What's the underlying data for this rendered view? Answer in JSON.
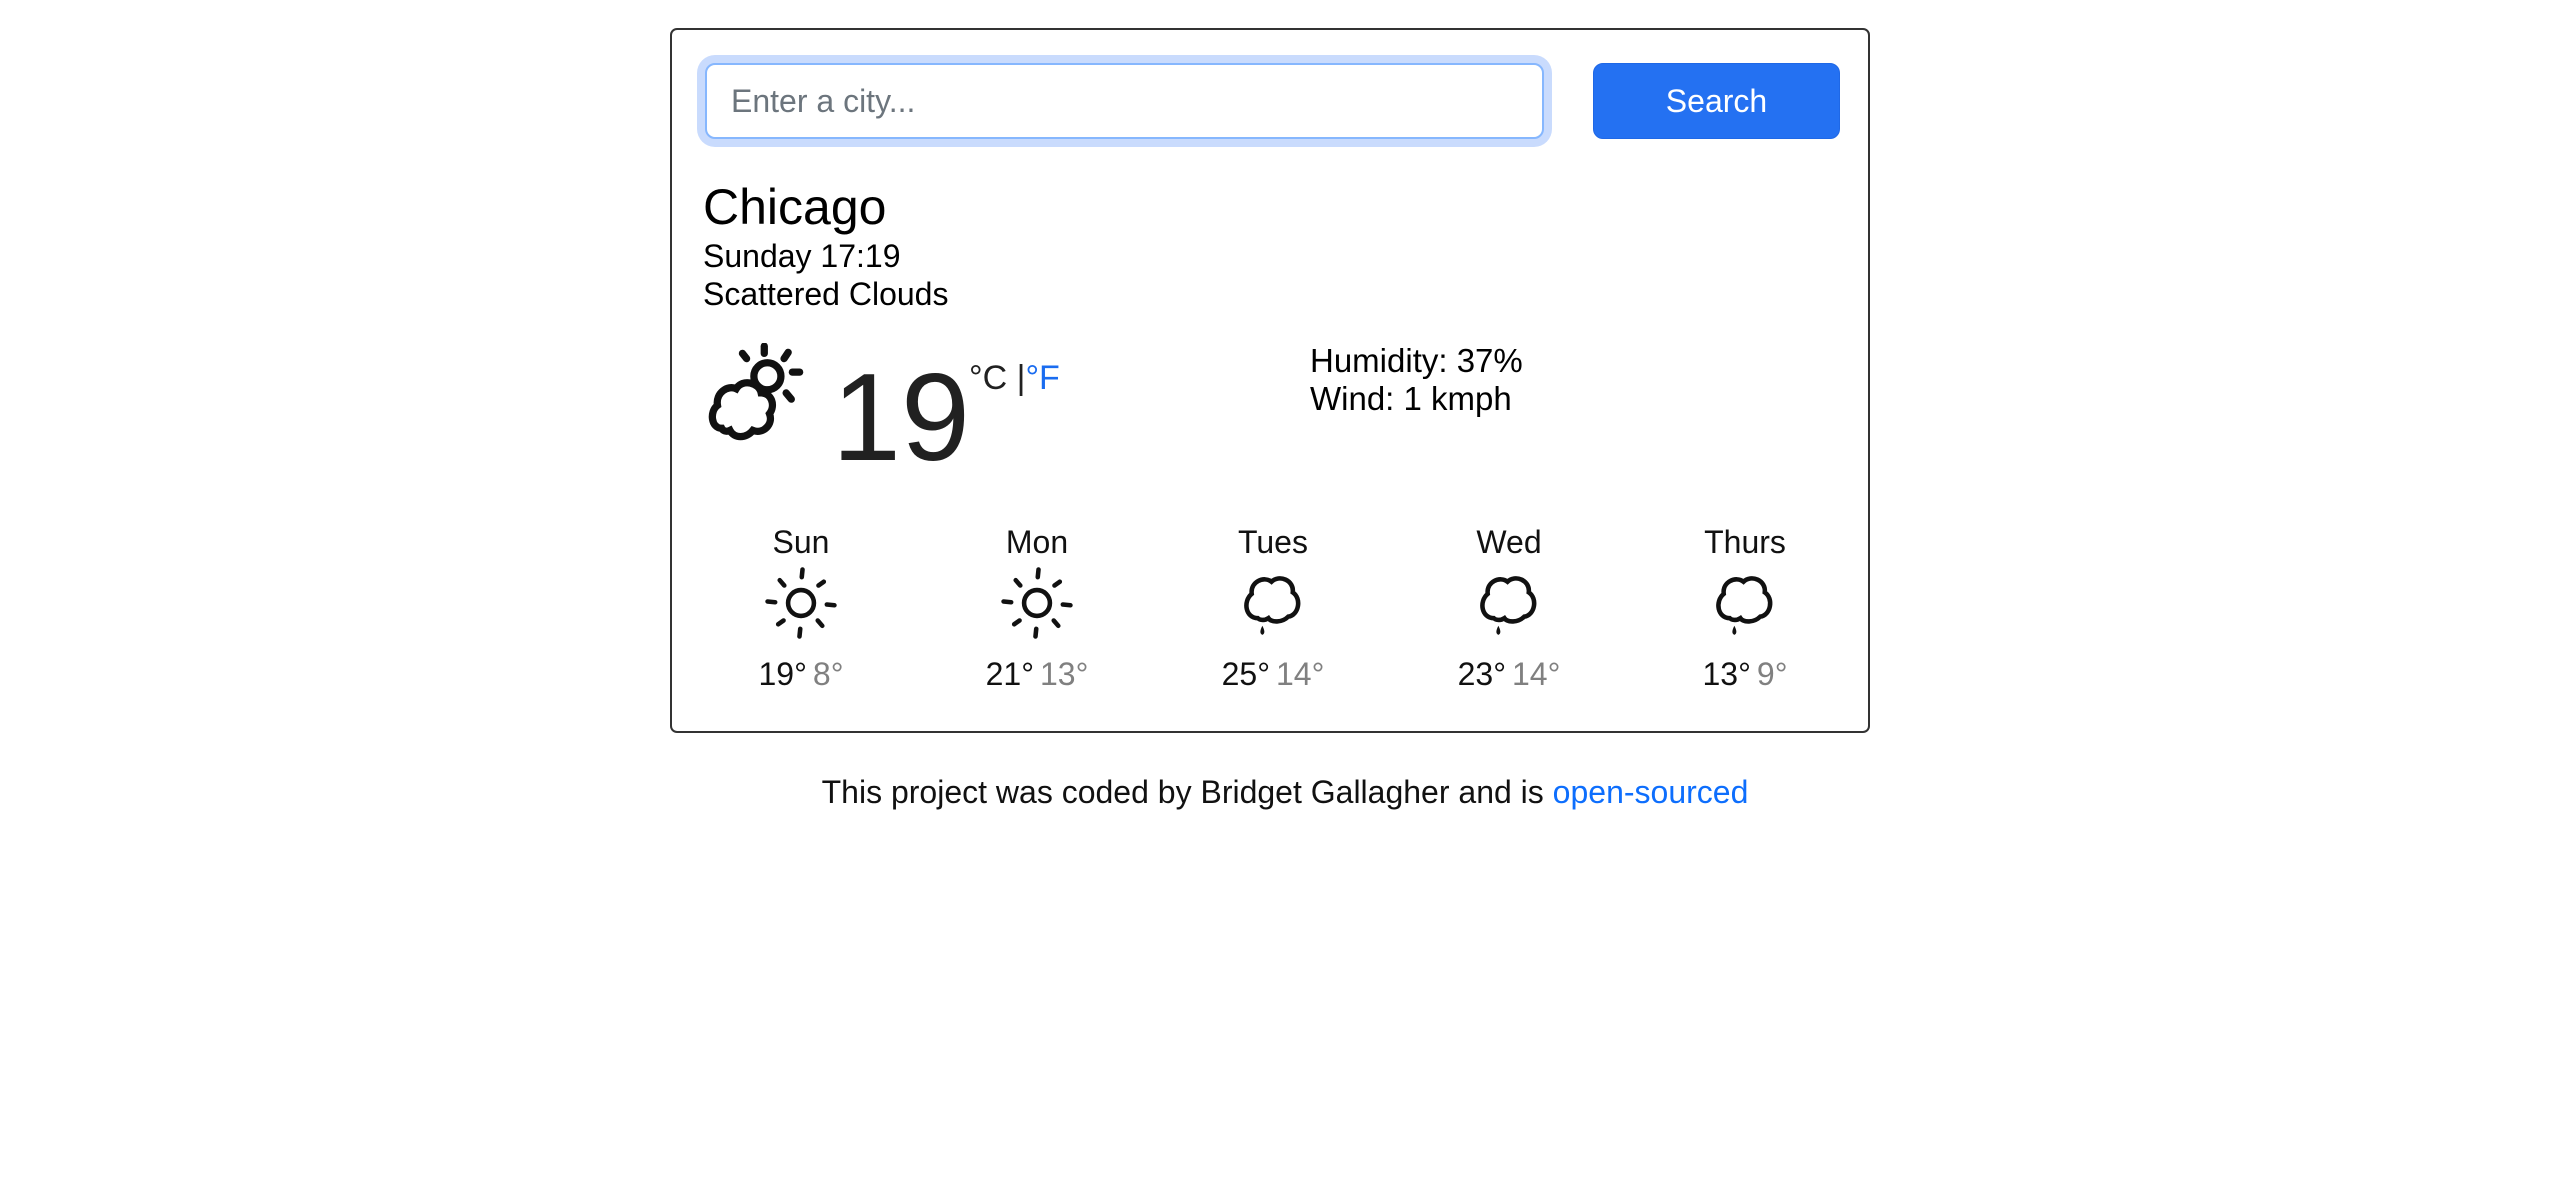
{
  "search": {
    "placeholder": "Enter a city...",
    "value": "",
    "button_label": "Search"
  },
  "current": {
    "city": "Chicago",
    "datetime": "Sunday 17:19",
    "description": "Scattered Clouds",
    "icon": "partly-cloudy-icon",
    "temperature": "19",
    "unit_celsius": "°C",
    "unit_separator": " |",
    "unit_fahrenheit": "°F",
    "humidity": "Humidity: 37%",
    "wind": "Wind: 1 kmph"
  },
  "forecast": [
    {
      "day": "Sun",
      "icon": "sun-icon",
      "max": "19°",
      "min": "8°"
    },
    {
      "day": "Mon",
      "icon": "sun-icon",
      "max": "21°",
      "min": "13°"
    },
    {
      "day": "Tues",
      "icon": "rain-cloud-icon",
      "max": "25°",
      "min": "14°"
    },
    {
      "day": "Wed",
      "icon": "rain-cloud-icon",
      "max": "23°",
      "min": "14°"
    },
    {
      "day": "Thurs",
      "icon": "rain-cloud-icon",
      "max": "13°",
      "min": "9°"
    }
  ],
  "footer": {
    "text": "This project was coded by Bridget Gallagher and is ",
    "link_text": "open-sourced"
  },
  "colors": {
    "accent": "#2471f2",
    "link": "#0d6efd",
    "min_temp": "#808080"
  }
}
